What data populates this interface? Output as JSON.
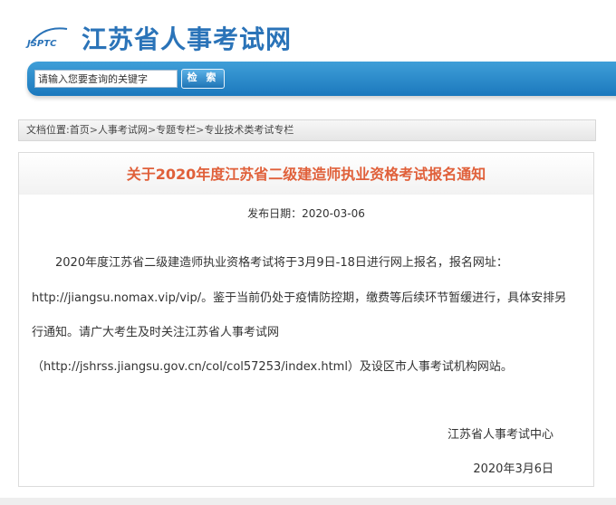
{
  "header": {
    "logo_mark": "JSPTC",
    "site_name": "江苏省人事考试网",
    "brand_color": "#2a73b8"
  },
  "search": {
    "placeholder": "请输入您要查询的关键字",
    "button_label": "检 索"
  },
  "breadcrumb": {
    "prefix": "文档位置:",
    "items": [
      "首页",
      "人事考试网",
      "专题专栏",
      "专业技术类考试专栏"
    ],
    "separator": ">"
  },
  "article": {
    "title": "关于2020年度江苏省二级建造师执业资格考试报名通知",
    "title_color": "#e0603a",
    "date_label": "发布日期：",
    "date_value": "2020-03-06",
    "lines": [
      "2020年度江苏省二级建造师执业资格考试将于3月9日-18日进行网上报名，报名网址：",
      "http://jiangsu.nomax.vip/vip/。鉴于当前仍处于疫情防控期，缴费等后续环节暂缓进行，具体安排另",
      "行通知。请广大考生及时关注江苏省人事考试网",
      "（http://jshrss.jiangsu.gov.cn/col/col57253/index.html）及设区市人事考试机构网站。"
    ],
    "signature": "江苏省人事考试中心",
    "sign_date": "2020年3月6日"
  }
}
